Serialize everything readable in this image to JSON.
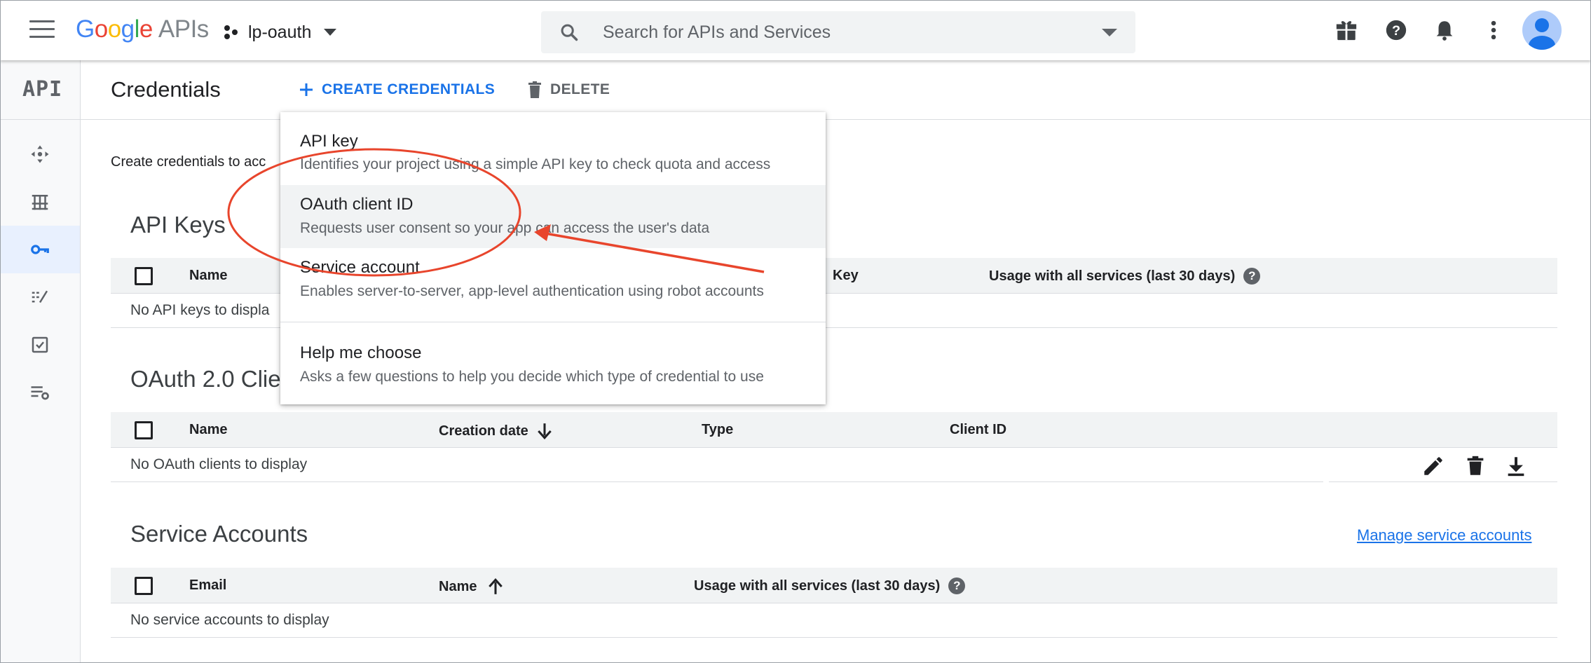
{
  "topbar": {
    "logo_google": [
      "G",
      "o",
      "o",
      "g",
      "l",
      "e"
    ],
    "logo_apis": "APIs",
    "project_name": "lp-oauth",
    "search_placeholder": "Search for APIs and Services",
    "icons": [
      "gift-icon",
      "help-icon",
      "notifications-bell-icon",
      "more-vert-icon",
      "account-avatar-icon"
    ]
  },
  "rail": {
    "logo": "API",
    "items": [
      {
        "icon": "dashboard-icon",
        "active": false
      },
      {
        "icon": "library-icon",
        "active": false
      },
      {
        "icon": "credentials-key-icon",
        "active": true
      },
      {
        "icon": "oauth-consent-icon",
        "active": false
      },
      {
        "icon": "domain-verification-icon",
        "active": false
      },
      {
        "icon": "page-usage-agreements-icon",
        "active": false
      }
    ]
  },
  "header": {
    "title": "Credentials",
    "create_label": "CREATE CREDENTIALS",
    "delete_label": "DELETE"
  },
  "intro_text": "Create credentials to acc",
  "api_keys": {
    "title": "API Keys",
    "columns": [
      "Name",
      "Key",
      "Usage with all services (last 30 days)"
    ],
    "empty": "No API keys to displa"
  },
  "oauth": {
    "title": "OAuth 2.0 Clie",
    "columns": [
      "Name",
      "Creation date",
      "Type",
      "Client ID"
    ],
    "empty": "No OAuth clients to display",
    "row_actions": [
      "edit-icon",
      "delete-icon",
      "download-icon"
    ]
  },
  "service_accounts": {
    "title": "Service Accounts",
    "manage_link": "Manage service accounts",
    "columns": [
      "Email",
      "Name",
      "Usage with all services (last 30 days)"
    ],
    "empty": "No service accounts to display"
  },
  "menu": {
    "items": [
      {
        "title": "API key",
        "desc": "Identifies your project using a simple API key to check quota and access"
      },
      {
        "title": "OAuth client ID",
        "desc": "Requests user consent so your app can access the user's data"
      },
      {
        "title": "Service account",
        "desc": "Enables server-to-server, app-level authentication using robot accounts"
      },
      {
        "title": "Help me choose",
        "desc": "Asks a few questions to help you decide which type of credential to use"
      }
    ]
  },
  "colors": {
    "accent": "#1a73e8",
    "annotation": "#e8452c",
    "active_nav_bg": "#e8f0fe"
  }
}
